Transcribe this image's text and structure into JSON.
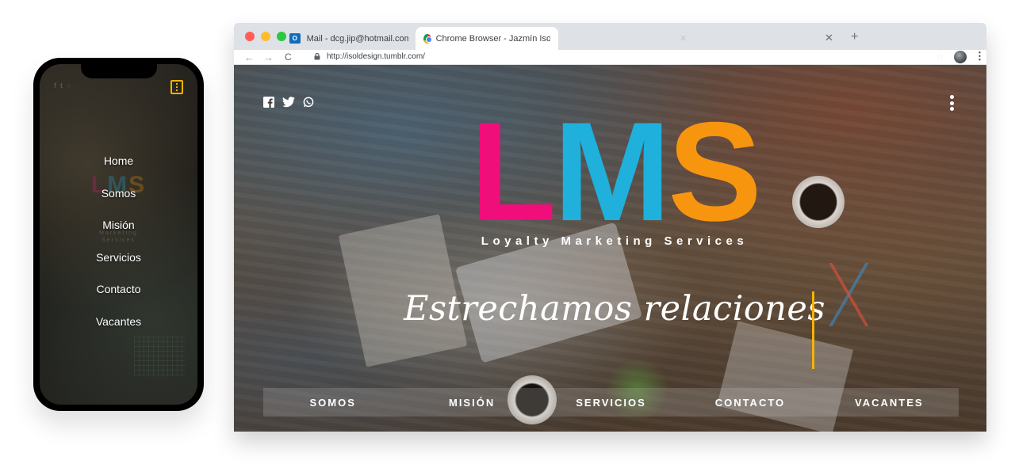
{
  "phone": {
    "menu": [
      "Home",
      "Somos",
      "Misión",
      "Servicios",
      "Contacto",
      "Vacantes"
    ],
    "ghost_logo": [
      "L",
      "M",
      "S"
    ],
    "ghost_tagline": [
      "Loyalty",
      "Marketing",
      "Services"
    ],
    "menu_button_color": "#f5b400"
  },
  "browser": {
    "tabs": [
      {
        "label": "Mail - dcg.jip@hotmail.com",
        "icon": "outlook-icon",
        "active": false
      },
      {
        "label": "Chrome Browser - Jazmín Isol Prado",
        "icon": "chrome-icon",
        "active": true
      }
    ],
    "url": "http://isoldesign.tumblr.com/",
    "traffic_lights": [
      "#ff5f57",
      "#febc2e",
      "#28c840"
    ]
  },
  "site": {
    "social_icons": [
      "facebook-icon",
      "twitter-icon",
      "whatsapp-icon"
    ],
    "logo_letters": [
      {
        "char": "L",
        "color": "#ef0e7a"
      },
      {
        "char": "M",
        "color": "#1fb0dc"
      },
      {
        "char": "S",
        "color": "#f7950f"
      }
    ],
    "tagline": "Loyalty Marketing Services",
    "headline": "Estrechamos relaciones",
    "accent_color": "#f5b400",
    "nav": [
      "SOMOS",
      "MISIÓN",
      "SERVICIOS",
      "CONTACTO",
      "VACANTES"
    ]
  }
}
